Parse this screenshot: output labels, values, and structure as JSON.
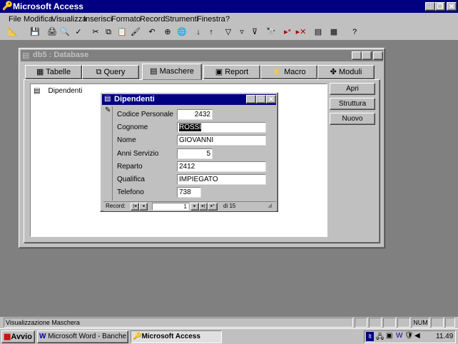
{
  "app": {
    "title": "Microsoft Access"
  },
  "menu": [
    "File",
    "Modifica",
    "Visualizza",
    "Inserisci",
    "Formato",
    "Record",
    "Strumenti",
    "Finestra",
    "?"
  ],
  "db_window": {
    "title": "db5 : Database",
    "tabs": [
      "Tabelle",
      "Query",
      "Maschere",
      "Report",
      "Macro",
      "Moduli"
    ],
    "active_tab": "Maschere",
    "items": [
      "Dipendenti"
    ],
    "buttons": {
      "open": "Apri",
      "design": "Struttura",
      "new": "Nuovo"
    }
  },
  "form": {
    "title": "Dipendenti",
    "fields": [
      {
        "label": "Codice Personale",
        "value": "2432"
      },
      {
        "label": "Cognome",
        "value": "ROSSI"
      },
      {
        "label": "Nome",
        "value": "GIOVANNI"
      },
      {
        "label": "Anni Servizio",
        "value": "5"
      },
      {
        "label": "Reparto",
        "value": "2412"
      },
      {
        "label": "Qualifica",
        "value": "IMPIEGATO"
      },
      {
        "label": "Telefono",
        "value": "738"
      }
    ],
    "nav": {
      "label": "Record:",
      "current": "1",
      "total": "di 15"
    }
  },
  "statusbar": {
    "text": "Visualizzazione Maschera",
    "num": "NUM"
  },
  "taskbar": {
    "start": "Avvio",
    "tasks": [
      "Microsoft Word - Banche d...",
      "Microsoft Access"
    ],
    "clock": "11.49"
  },
  "colors": {
    "titlebar": "#000080",
    "face": "#c0c0c0",
    "desktop": "#808080",
    "inactive_title": "#808080"
  }
}
